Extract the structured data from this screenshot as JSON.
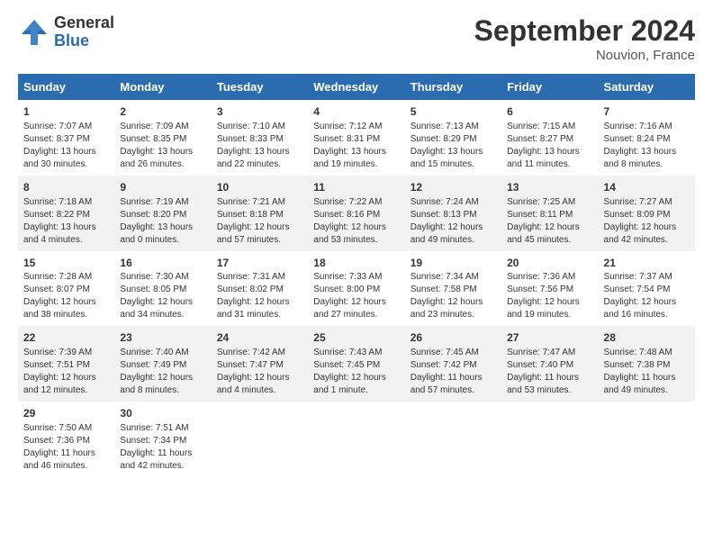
{
  "header": {
    "logo_general": "General",
    "logo_blue": "Blue",
    "month_title": "September 2024",
    "location": "Nouvion, France"
  },
  "days_of_week": [
    "Sunday",
    "Monday",
    "Tuesday",
    "Wednesday",
    "Thursday",
    "Friday",
    "Saturday"
  ],
  "weeks": [
    [
      {
        "day": "1",
        "lines": [
          "Sunrise: 7:07 AM",
          "Sunset: 8:37 PM",
          "Daylight: 13 hours",
          "and 30 minutes."
        ]
      },
      {
        "day": "2",
        "lines": [
          "Sunrise: 7:09 AM",
          "Sunset: 8:35 PM",
          "Daylight: 13 hours",
          "and 26 minutes."
        ]
      },
      {
        "day": "3",
        "lines": [
          "Sunrise: 7:10 AM",
          "Sunset: 8:33 PM",
          "Daylight: 13 hours",
          "and 22 minutes."
        ]
      },
      {
        "day": "4",
        "lines": [
          "Sunrise: 7:12 AM",
          "Sunset: 8:31 PM",
          "Daylight: 13 hours",
          "and 19 minutes."
        ]
      },
      {
        "day": "5",
        "lines": [
          "Sunrise: 7:13 AM",
          "Sunset: 8:29 PM",
          "Daylight: 13 hours",
          "and 15 minutes."
        ]
      },
      {
        "day": "6",
        "lines": [
          "Sunrise: 7:15 AM",
          "Sunset: 8:27 PM",
          "Daylight: 13 hours",
          "and 11 minutes."
        ]
      },
      {
        "day": "7",
        "lines": [
          "Sunrise: 7:16 AM",
          "Sunset: 8:24 PM",
          "Daylight: 13 hours",
          "and 8 minutes."
        ]
      }
    ],
    [
      {
        "day": "8",
        "lines": [
          "Sunrise: 7:18 AM",
          "Sunset: 8:22 PM",
          "Daylight: 13 hours",
          "and 4 minutes."
        ]
      },
      {
        "day": "9",
        "lines": [
          "Sunrise: 7:19 AM",
          "Sunset: 8:20 PM",
          "Daylight: 13 hours",
          "and 0 minutes."
        ]
      },
      {
        "day": "10",
        "lines": [
          "Sunrise: 7:21 AM",
          "Sunset: 8:18 PM",
          "Daylight: 12 hours",
          "and 57 minutes."
        ]
      },
      {
        "day": "11",
        "lines": [
          "Sunrise: 7:22 AM",
          "Sunset: 8:16 PM",
          "Daylight: 12 hours",
          "and 53 minutes."
        ]
      },
      {
        "day": "12",
        "lines": [
          "Sunrise: 7:24 AM",
          "Sunset: 8:13 PM",
          "Daylight: 12 hours",
          "and 49 minutes."
        ]
      },
      {
        "day": "13",
        "lines": [
          "Sunrise: 7:25 AM",
          "Sunset: 8:11 PM",
          "Daylight: 12 hours",
          "and 45 minutes."
        ]
      },
      {
        "day": "14",
        "lines": [
          "Sunrise: 7:27 AM",
          "Sunset: 8:09 PM",
          "Daylight: 12 hours",
          "and 42 minutes."
        ]
      }
    ],
    [
      {
        "day": "15",
        "lines": [
          "Sunrise: 7:28 AM",
          "Sunset: 8:07 PM",
          "Daylight: 12 hours",
          "and 38 minutes."
        ]
      },
      {
        "day": "16",
        "lines": [
          "Sunrise: 7:30 AM",
          "Sunset: 8:05 PM",
          "Daylight: 12 hours",
          "and 34 minutes."
        ]
      },
      {
        "day": "17",
        "lines": [
          "Sunrise: 7:31 AM",
          "Sunset: 8:02 PM",
          "Daylight: 12 hours",
          "and 31 minutes."
        ]
      },
      {
        "day": "18",
        "lines": [
          "Sunrise: 7:33 AM",
          "Sunset: 8:00 PM",
          "Daylight: 12 hours",
          "and 27 minutes."
        ]
      },
      {
        "day": "19",
        "lines": [
          "Sunrise: 7:34 AM",
          "Sunset: 7:58 PM",
          "Daylight: 12 hours",
          "and 23 minutes."
        ]
      },
      {
        "day": "20",
        "lines": [
          "Sunrise: 7:36 AM",
          "Sunset: 7:56 PM",
          "Daylight: 12 hours",
          "and 19 minutes."
        ]
      },
      {
        "day": "21",
        "lines": [
          "Sunrise: 7:37 AM",
          "Sunset: 7:54 PM",
          "Daylight: 12 hours",
          "and 16 minutes."
        ]
      }
    ],
    [
      {
        "day": "22",
        "lines": [
          "Sunrise: 7:39 AM",
          "Sunset: 7:51 PM",
          "Daylight: 12 hours",
          "and 12 minutes."
        ]
      },
      {
        "day": "23",
        "lines": [
          "Sunrise: 7:40 AM",
          "Sunset: 7:49 PM",
          "Daylight: 12 hours",
          "and 8 minutes."
        ]
      },
      {
        "day": "24",
        "lines": [
          "Sunrise: 7:42 AM",
          "Sunset: 7:47 PM",
          "Daylight: 12 hours",
          "and 4 minutes."
        ]
      },
      {
        "day": "25",
        "lines": [
          "Sunrise: 7:43 AM",
          "Sunset: 7:45 PM",
          "Daylight: 12 hours",
          "and 1 minute."
        ]
      },
      {
        "day": "26",
        "lines": [
          "Sunrise: 7:45 AM",
          "Sunset: 7:42 PM",
          "Daylight: 11 hours",
          "and 57 minutes."
        ]
      },
      {
        "day": "27",
        "lines": [
          "Sunrise: 7:47 AM",
          "Sunset: 7:40 PM",
          "Daylight: 11 hours",
          "and 53 minutes."
        ]
      },
      {
        "day": "28",
        "lines": [
          "Sunrise: 7:48 AM",
          "Sunset: 7:38 PM",
          "Daylight: 11 hours",
          "and 49 minutes."
        ]
      }
    ],
    [
      {
        "day": "29",
        "lines": [
          "Sunrise: 7:50 AM",
          "Sunset: 7:36 PM",
          "Daylight: 11 hours",
          "and 46 minutes."
        ]
      },
      {
        "day": "30",
        "lines": [
          "Sunrise: 7:51 AM",
          "Sunset: 7:34 PM",
          "Daylight: 11 hours",
          "and 42 minutes."
        ]
      },
      {
        "day": "",
        "lines": []
      },
      {
        "day": "",
        "lines": []
      },
      {
        "day": "",
        "lines": []
      },
      {
        "day": "",
        "lines": []
      },
      {
        "day": "",
        "lines": []
      }
    ]
  ]
}
